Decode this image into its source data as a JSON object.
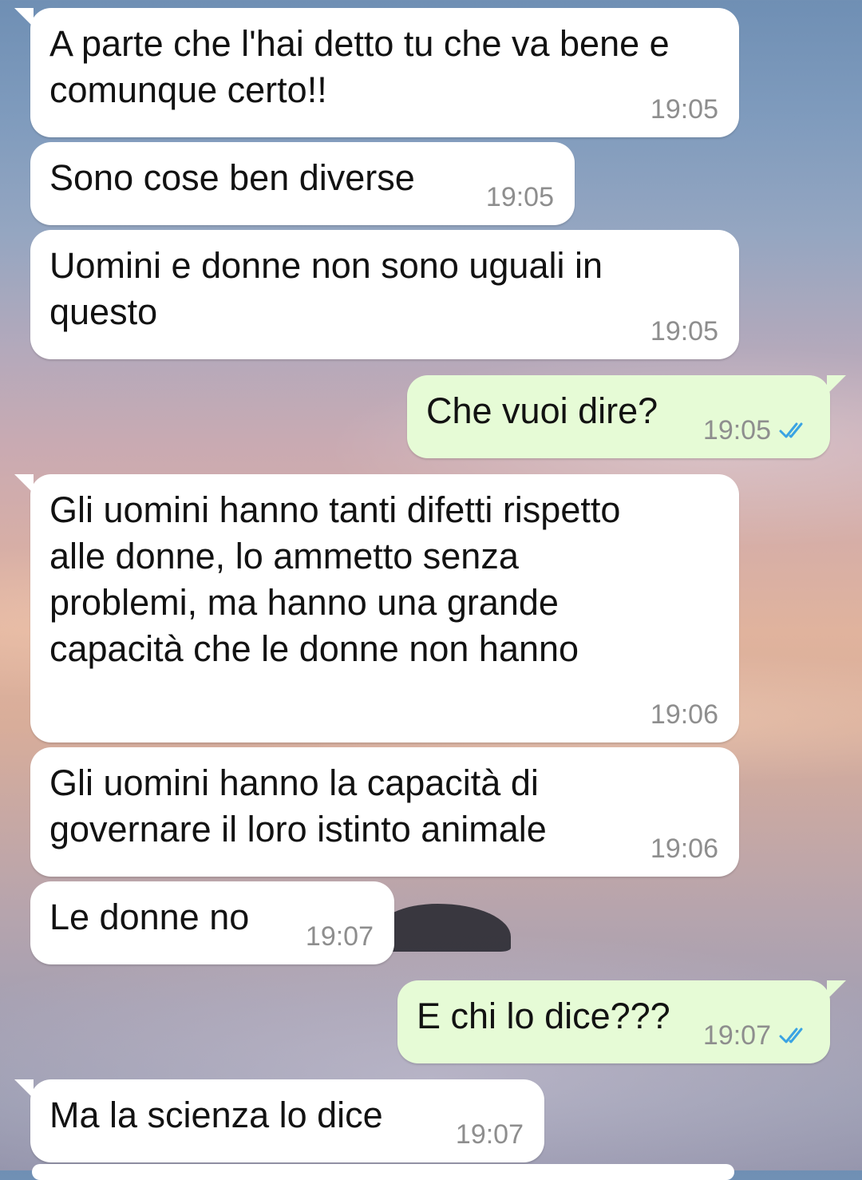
{
  "colors": {
    "incoming_bubble": "#ffffff",
    "outgoing_bubble": "#e6fbd6",
    "timestamp": "#8e8e8e",
    "read_ticks": "#3aa3e3"
  },
  "messages": [
    {
      "direction": "in",
      "text": "A parte che l'hai detto tu che va bene e\ncomunque certo!!",
      "time": "19:05"
    },
    {
      "direction": "in",
      "text": "Sono cose ben diverse",
      "time": "19:05"
    },
    {
      "direction": "in",
      "text": "Uomini e donne non sono uguali in\nquesto",
      "time": "19:05"
    },
    {
      "direction": "out",
      "text": "Che vuoi dire?",
      "time": "19:05",
      "status_icon": "double-check-read-icon"
    },
    {
      "direction": "in",
      "text": "Gli uomini hanno tanti difetti rispetto\nalle donne, lo ammetto senza\nproblemi, ma hanno una grande\ncapacità che le donne non hanno",
      "time": "19:06"
    },
    {
      "direction": "in",
      "text": "Gli uomini hanno la capacità di\ngovernare il loro istinto animale",
      "time": "19:06"
    },
    {
      "direction": "in",
      "text": "Le donne no",
      "time": "19:07"
    },
    {
      "direction": "out",
      "text": "E chi lo dice???",
      "time": "19:07",
      "status_icon": "double-check-read-icon"
    },
    {
      "direction": "in",
      "text": "Ma la scienza lo dice",
      "time": "19:07"
    }
  ]
}
